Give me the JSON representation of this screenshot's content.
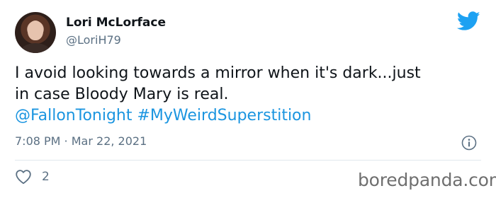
{
  "user": {
    "name": "Lori McLorface",
    "handle": "@LoriH79"
  },
  "tweet": {
    "line1": "I avoid looking towards a mirror when it's dark...just",
    "line2": "in case Bloody Mary is real.",
    "mention": "@FallonTonight",
    "hashtag": "#MyWeirdSuperstition"
  },
  "meta": {
    "time": "7:08 PM",
    "separator": " · ",
    "date": "Mar 22, 2021"
  },
  "actions": {
    "like_count": "2"
  },
  "watermark": "boredpanda.com",
  "icons": {
    "logo": "twitter-bird-icon",
    "info": "info-icon",
    "like": "heart-icon"
  },
  "colors": {
    "link": "#1b95e0",
    "brand": "#1da1f2",
    "secondary_text": "#5b7083"
  }
}
